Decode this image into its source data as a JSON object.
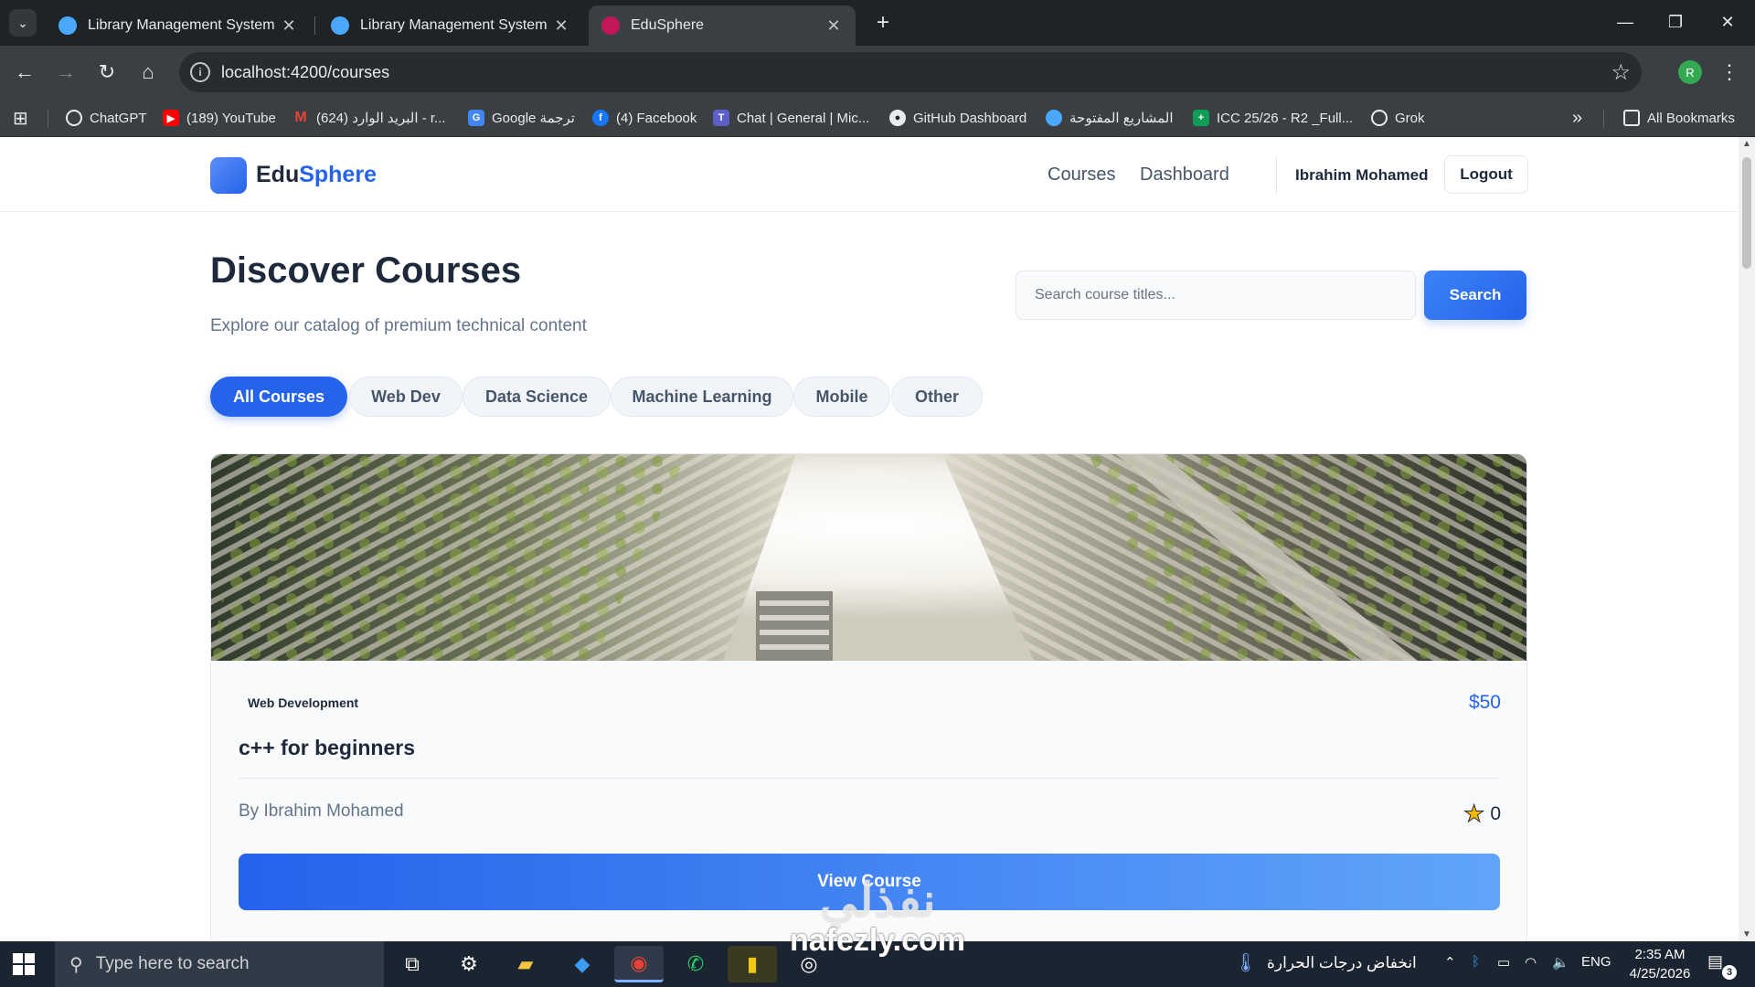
{
  "browser": {
    "tabs": [
      {
        "title": "Library Management System | Library Management System",
        "close": "✕",
        "favicon_color": "#4aa8ff"
      },
      {
        "title": "Library Management System | Library Management System",
        "close": "✕",
        "favicon_color": "#4aa8ff"
      },
      {
        "title": "EduSphere",
        "close": "✕",
        "favicon_color": "#c2185b"
      }
    ],
    "new_tab": "+",
    "url": "localhost:4200/courses",
    "profile_initial": "R",
    "bookmarks": [
      {
        "label": "ChatGPT",
        "icon": "chatgpt-icon",
        "color": "#ffffff"
      },
      {
        "label": "(189) YouTube",
        "icon": "youtube-icon",
        "color": "#ff0000"
      },
      {
        "label": "(624) البريد الوارد - r...",
        "icon": "gmail-icon",
        "color": "#ea4335"
      },
      {
        "label": "Google ترجمة",
        "icon": "translate-icon",
        "color": "#4285f4"
      },
      {
        "label": "(4) Facebook",
        "icon": "facebook-icon",
        "color": "#1877f2"
      },
      {
        "label": "Chat | General | Mic...",
        "icon": "teams-icon",
        "color": "#5b5fc7"
      },
      {
        "label": "GitHub Dashboard",
        "icon": "github-icon",
        "color": "#ffffff"
      },
      {
        "label": "المشاريع المفتوحة",
        "icon": "projects-icon",
        "color": "#4aa8ff"
      },
      {
        "label": "ICC 25/26 - R2 _Full...",
        "icon": "sheets-icon",
        "color": "#0f9d58"
      },
      {
        "label": "Grok",
        "icon": "grok-icon",
        "color": "#ffffff"
      }
    ],
    "bookmarks_more": "»",
    "all_bookmarks": "All Bookmarks"
  },
  "header": {
    "logo_part1": "Edu",
    "logo_part2": "Sphere",
    "nav": [
      "Courses",
      "Dashboard"
    ],
    "user_name": "Ibrahim Mohamed",
    "logout_label": "Logout"
  },
  "hero": {
    "title": "Discover Courses",
    "subtitle": "Explore our catalog of premium technical content",
    "search_placeholder": "Search course titles...",
    "search_label": "Search"
  },
  "filters": {
    "active_index": 0,
    "items": [
      "All Courses",
      "Web Dev",
      "Data Science",
      "Machine Learning",
      "Mobile",
      "Other"
    ]
  },
  "courses": [
    {
      "category": "Web Development",
      "price": "$50",
      "title": "c++ for beginners",
      "author": "By Ibrahim Mohamed",
      "rating": "0",
      "cta": "View Course"
    }
  ],
  "watermark": {
    "line1": "نفذلي",
    "line2": "nafezly.com"
  },
  "taskbar": {
    "search_placeholder": "Type here to search",
    "weather_text": "انخفاض درجات الحرارة",
    "language": "ENG",
    "time": "2:35 AM",
    "date": "4/25/2026",
    "notification_count": "3"
  }
}
